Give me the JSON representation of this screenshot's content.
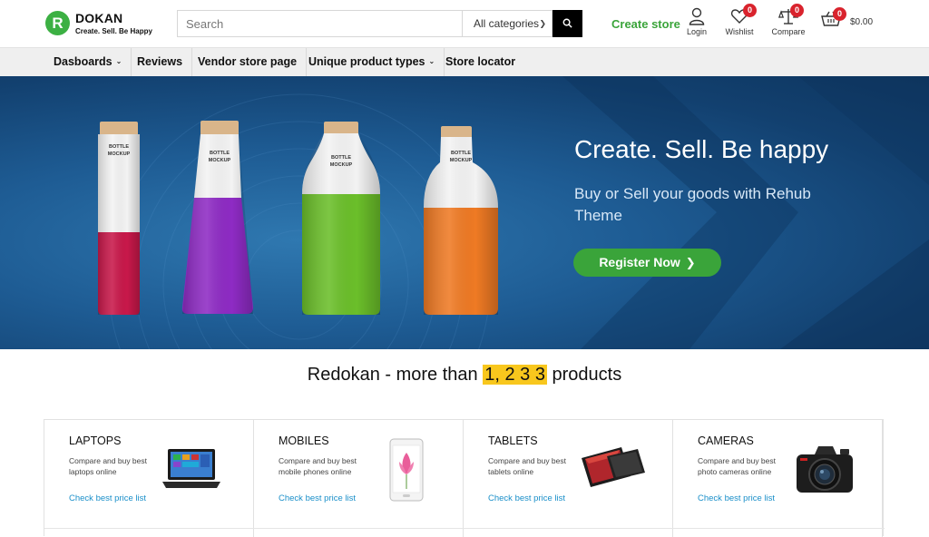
{
  "header": {
    "logo_letter": "R",
    "logo_name": "DOKAN",
    "logo_tagline": "Create. Sell. Be Happy",
    "search_placeholder": "Search",
    "category_select": "All categories",
    "create_store": "Create store",
    "login_label": "Login",
    "wishlist_label": "Wishlist",
    "wishlist_count": "0",
    "compare_label": "Compare",
    "compare_count": "0",
    "cart_count": "0",
    "cart_total": "$0.00"
  },
  "nav": {
    "items": [
      {
        "label": "Dasboards",
        "has_dropdown": true
      },
      {
        "label": "Reviews",
        "has_dropdown": false
      },
      {
        "label": "Vendor store page",
        "has_dropdown": false
      },
      {
        "label": "Unique product types",
        "has_dropdown": true
      },
      {
        "label": "Store locator",
        "has_dropdown": false
      }
    ]
  },
  "hero": {
    "title": "Create. Sell. Be happy",
    "subtitle": "Buy or Sell your goods with Rehub Theme",
    "button": "Register Now",
    "bottle_label_line1": "BOTTLE",
    "bottle_label_line2": "MOCKUP",
    "bottle_colors": [
      "#c8184a",
      "#8e2bc4",
      "#6bbf2a",
      "#ef7a24"
    ]
  },
  "headline": {
    "prefix": "Redokan - more than ",
    "count": "1, 2 3 3",
    "suffix": " products"
  },
  "categories": [
    {
      "title": "LAPTOPS",
      "desc": "Compare and buy best laptops online",
      "link": "Check best price list",
      "icon": "laptop-image"
    },
    {
      "title": "MOBILES",
      "desc": "Compare and buy best mobile phones online",
      "link": "Check best price list",
      "icon": "mobile-image"
    },
    {
      "title": "TABLETS",
      "desc": "Compare and buy best tablets online",
      "link": "Check best price list",
      "icon": "tablet-image"
    },
    {
      "title": "CAMERAS",
      "desc": "Compare and buy best photo cameras online",
      "link": "Check best price list",
      "icon": "camera-image"
    }
  ],
  "colors": {
    "brand_green": "#3aa43a",
    "badge_red": "#d9232d",
    "highlight_yellow": "#f8c71d",
    "link_blue": "#1a8fc9",
    "hero_blue": "#1e5c94"
  }
}
